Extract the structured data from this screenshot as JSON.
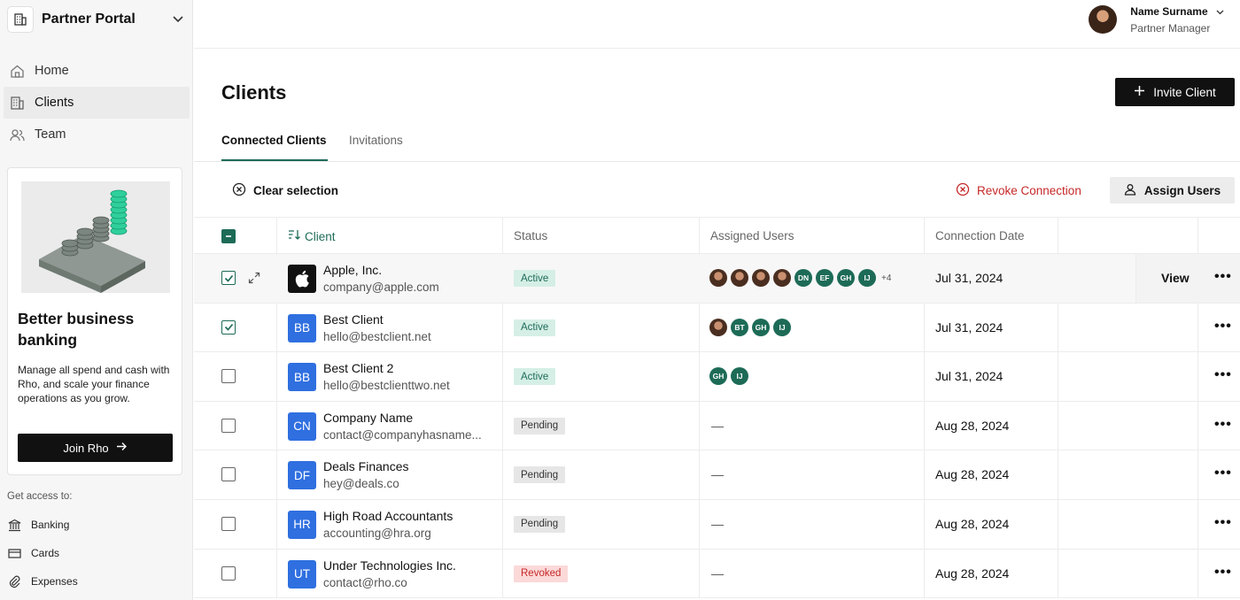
{
  "sidebar": {
    "org_name": "Partner Portal",
    "nav": [
      {
        "label": "Home",
        "icon": "home-icon"
      },
      {
        "label": "Clients",
        "icon": "building-icon",
        "active": true
      },
      {
        "label": "Team",
        "icon": "team-icon"
      }
    ],
    "promo": {
      "title": "Better business banking",
      "text": "Manage all spend and cash with Rho, and scale your finance operations as you grow.",
      "button": "Join Rho"
    },
    "access_label": "Get access to:",
    "access": [
      {
        "label": "Banking",
        "icon": "bank-icon"
      },
      {
        "label": "Cards",
        "icon": "card-icon"
      },
      {
        "label": "Expenses",
        "icon": "paperclip-icon"
      }
    ]
  },
  "header": {
    "user_name": "Name Surname",
    "user_role": "Partner Manager"
  },
  "page": {
    "title": "Clients",
    "invite_label": "Invite Client",
    "tabs": [
      "Connected Clients",
      "Invitations"
    ],
    "clear_selection": "Clear selection",
    "revoke_label": "Revoke Connection",
    "assign_label": "Assign Users"
  },
  "table": {
    "columns": [
      "Client",
      "Status",
      "Assigned Users",
      "Connection Date"
    ],
    "view_label": "View",
    "rows": [
      {
        "name": "Apple, Inc.",
        "email": "company@apple.com",
        "logo": "",
        "logo_type": "apple",
        "status": "Active",
        "users": [
          "photo",
          "photo",
          "photo",
          "photo",
          "DN",
          "EF",
          "GH",
          "IJ"
        ],
        "more": "+4",
        "date": "Jul 31, 2024",
        "checked": true
      },
      {
        "name": "Best Client",
        "email": "hello@bestclient.net",
        "logo": "BB",
        "status": "Active",
        "users": [
          "photo",
          "BT",
          "GH",
          "IJ"
        ],
        "more": "",
        "date": "Jul 31, 2024",
        "checked": true
      },
      {
        "name": "Best Client 2",
        "email": "hello@bestclienttwo.net",
        "logo": "BB",
        "status": "Active",
        "users": [
          "GH",
          "IJ"
        ],
        "more": "",
        "date": "Jul 31, 2024",
        "checked": false
      },
      {
        "name": "Company Name",
        "email": "contact@companyhasname...",
        "logo": "CN",
        "status": "Pending",
        "users": [],
        "more": "",
        "date": "Aug 28, 2024",
        "checked": false
      },
      {
        "name": "Deals Finances",
        "email": "hey@deals.co",
        "logo": "DF",
        "status": "Pending",
        "users": [],
        "more": "",
        "date": "Aug 28, 2024",
        "checked": false
      },
      {
        "name": "High Road Accountants",
        "email": "accounting@hra.org",
        "logo": "HR",
        "status": "Pending",
        "users": [],
        "more": "",
        "date": "Aug 28, 2024",
        "checked": false
      },
      {
        "name": "Under Technologies Inc.",
        "email": "contact@rho.co",
        "logo": "UT",
        "status": "Revoked",
        "users": [],
        "more": "",
        "date": "Aug 28, 2024",
        "checked": false
      }
    ],
    "empty_users": "—"
  },
  "colors": {
    "accent": "#1d6b57",
    "logo_blue": "#2f6fe0",
    "danger": "#c62828"
  }
}
